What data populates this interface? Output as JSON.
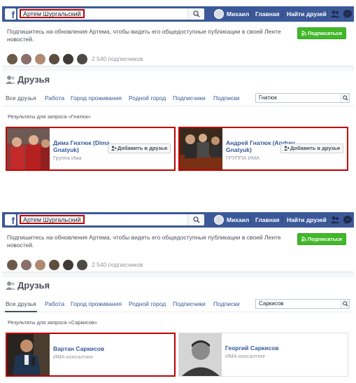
{
  "panels": [
    {
      "topbar": {
        "search_value": "Артем Шургальский",
        "user_name": "Михаил",
        "home": "Главная",
        "find_friends": "Найти друзей"
      },
      "follow": {
        "text": "Подпишитесь на обновления Артема, чтобы видеть его общедоступные публикации в своей Ленте новостей.",
        "subscribe_label": "Подписаться",
        "follower_count": "2 540 подписчиков"
      },
      "friends": {
        "title": "Друзья",
        "tabs": [
          "Все друзья",
          "Работа",
          "Город проживания",
          "Родной город",
          "Подписчики",
          "Подписки"
        ],
        "search_value": "Гнатюк",
        "results_label": "Результаты для запроса «Гнатюк»",
        "cards": [
          {
            "name": "Дима Гнатюк (Dima Gnatyuk)",
            "subtitle": "Группа Има",
            "button": "Добавить в друзья",
            "highlighted": true
          },
          {
            "name": "Андрей Гнатюк (Andrey Gnatyuk)",
            "subtitle": "ГРУППА ИМА",
            "button": "Добавить в друзья",
            "highlighted": true
          }
        ]
      }
    },
    {
      "topbar": {
        "search_value": "Артем Шургальский",
        "user_name": "Михаил",
        "home": "Главная",
        "find_friends": "Найти друзей"
      },
      "follow": {
        "text": "Подпишитесь на обновления Артема, чтобы видеть его общедоступные публикации в своей Ленте новостей.",
        "subscribe_label": "Подписаться",
        "follower_count": "2 540 подписчиков"
      },
      "friends": {
        "title": "Друзья",
        "tabs": [
          "Все друзья",
          "Работа",
          "Город проживания",
          "Родной город",
          "Подписчики",
          "Подписки"
        ],
        "search_value": "Саркисов",
        "results_label": "Результаты для запроса «Саркисов»",
        "cards": [
          {
            "name": "Вартан Саркисов",
            "subtitle": "ИМА-консалтинг",
            "highlighted": true
          },
          {
            "name": "Георгий Саркисов",
            "subtitle": "ИМА-консалтинг",
            "highlighted": false
          }
        ]
      }
    }
  ],
  "colors": {
    "brand_blue": "#3b5998",
    "link_blue": "#365899",
    "subscribe_green": "#42b72a",
    "highlight_red": "#c00000"
  },
  "icons": [
    "search-icon",
    "friend-requests-icon",
    "messenger-icon",
    "rss-icon",
    "friends-icon",
    "add-friend-icon"
  ]
}
